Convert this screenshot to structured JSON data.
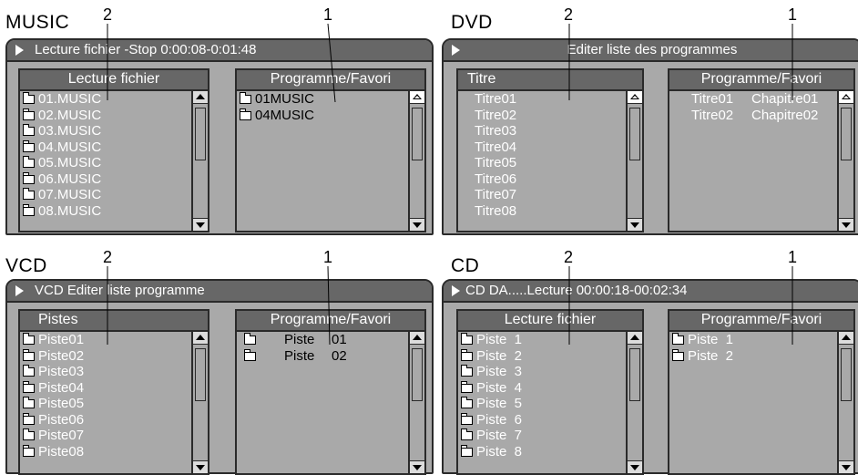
{
  "quadrants": {
    "music": {
      "title": "MUSIC",
      "callout_left": "2",
      "callout_right": "1",
      "titlebar": "Lecture fichier -Stop  0:00:08-0:01:48",
      "left_header": "Lecture fichier",
      "right_header": "Programme/Favori",
      "left_items": [
        "01.MUSIC",
        "02.MUSIC",
        "03.MUSIC",
        "04.MUSIC",
        "05.MUSIC",
        "06.MUSIC",
        "07.MUSIC",
        "08.MUSIC"
      ],
      "right_items": [
        "01MUSIC",
        "04MUSIC"
      ]
    },
    "dvd": {
      "title": "DVD",
      "callout_left": "2",
      "callout_right": "1",
      "titlebar": "Editer liste des programmes",
      "left_header": "Titre",
      "right_header": "Programme/Favori",
      "left_items": [
        "Titre01",
        "Titre02",
        "Titre03",
        "Titre04",
        "Titre05",
        "Titre06",
        "Titre07",
        "Titre08"
      ],
      "right_items": [
        {
          "title": "Titre01",
          "chapter": "Chapitre01"
        },
        {
          "title": "Titre02",
          "chapter": "Chapitre02"
        }
      ]
    },
    "vcd": {
      "title": "VCD",
      "callout_left": "2",
      "callout_right": "1",
      "titlebar": "VCD Editer liste programme",
      "left_header": "Pistes",
      "right_header": "Programme/Favori",
      "left_items": [
        "Piste01",
        "Piste02",
        "Piste03",
        "Piste04",
        "Piste05",
        "Piste06",
        "Piste07",
        "Piste08"
      ],
      "right_items": [
        {
          "label": "Piste",
          "number": "01"
        },
        {
          "label": "Piste",
          "number": "02"
        }
      ]
    },
    "cd": {
      "title": "CD",
      "callout_left": "2",
      "callout_right": "1",
      "titlebar": "CD DA.....Lecture  00:00:18-00:02:34",
      "left_header": "Lecture fichier",
      "right_header": "Programme/Favori",
      "left_items": [
        "Piste  1",
        "Piste  2",
        "Piste  3",
        "Piste  4",
        "Piste  5",
        "Piste  6",
        "Piste  7",
        "Piste  8"
      ],
      "right_items": [
        "Piste  1",
        "Piste  2"
      ]
    }
  },
  "icons": {
    "play": "play-icon",
    "folder": "folder-icon",
    "scroll_up": "arrow-up-icon",
    "scroll_down": "arrow-down-icon"
  },
  "colors": {
    "panel": "#a9a9a9",
    "bar": "#676767",
    "text_light": "#ffffff",
    "border": "#2a2a2a"
  }
}
